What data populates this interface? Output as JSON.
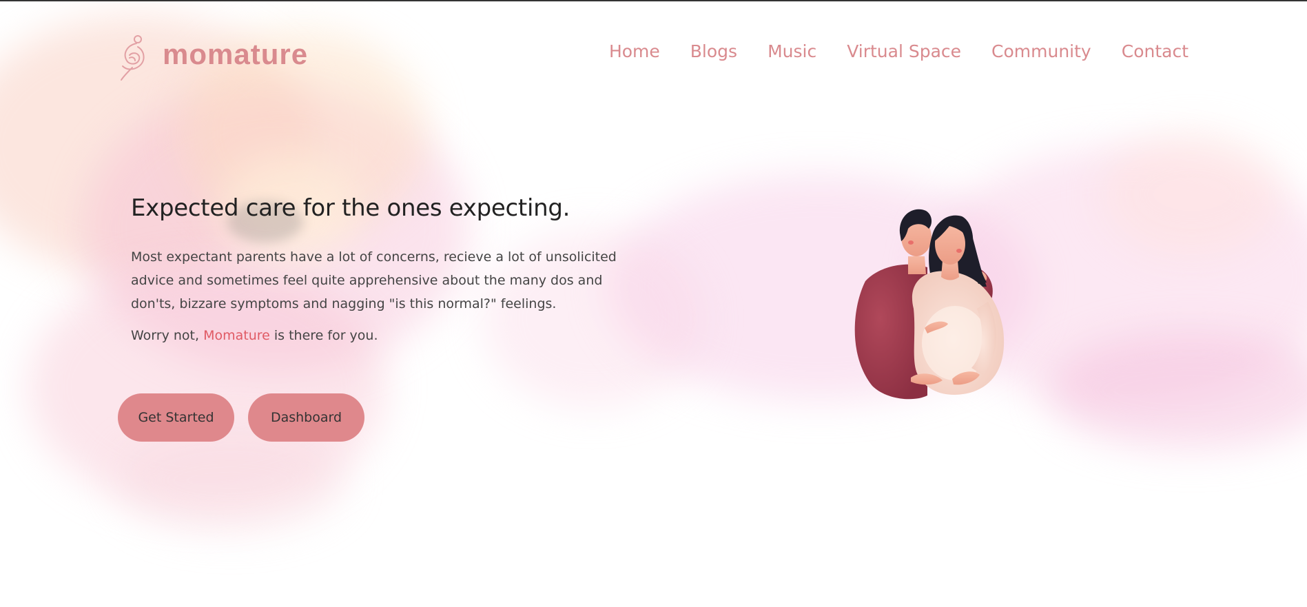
{
  "brand": {
    "name": "momature",
    "icon": "mother-logo-icon",
    "color": "#d98a8e"
  },
  "nav": {
    "items": [
      {
        "label": "Home"
      },
      {
        "label": "Blogs"
      },
      {
        "label": "Music"
      },
      {
        "label": "Virtual Space"
      },
      {
        "label": "Community"
      },
      {
        "label": "Contact"
      }
    ]
  },
  "hero": {
    "title": "Expected care for the ones expecting.",
    "description": "Most expectant parents have a lot of concerns, recieve a lot of unsolicited advice and sometimes feel quite apprehensive about the many dos and don'ts, bizzare symptoms and nagging \"is this normal?\" feelings.",
    "note_prefix": "Worry not, ",
    "note_brand": "Momature",
    "note_suffix": " is there for you.",
    "accent_color": "#e05a64"
  },
  "buttons": {
    "get_started": "Get Started",
    "dashboard": "Dashboard",
    "color": "#df888c"
  },
  "illustration": {
    "icon": "expecting-couple-illustration"
  }
}
